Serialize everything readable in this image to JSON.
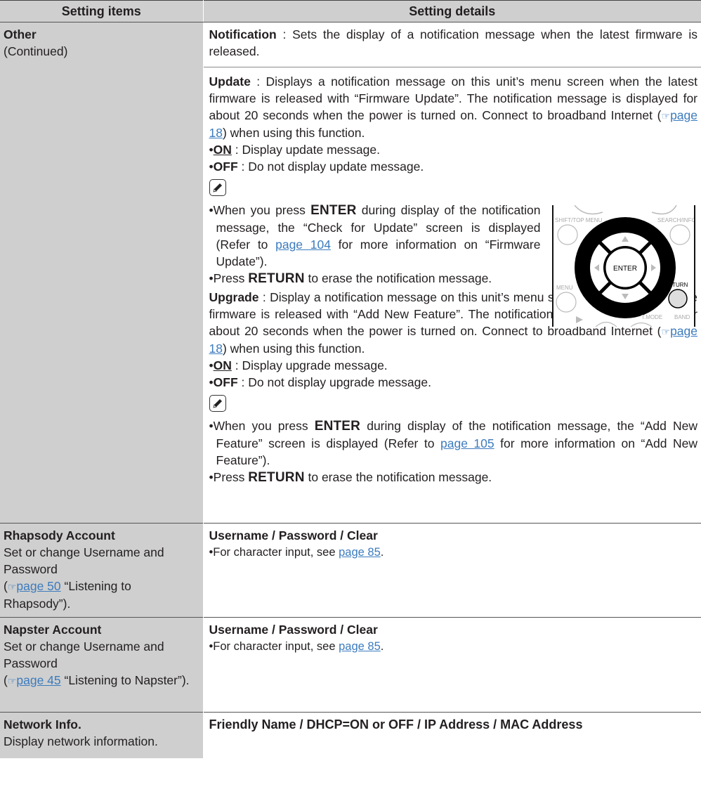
{
  "header": {
    "col1": "Setting items",
    "col2": "Setting details"
  },
  "other": {
    "title": "Other",
    "subtitle": "(Continued)",
    "notification": {
      "term": "Notification",
      "text": " : Sets the display of a notification message when the latest firmware is released."
    },
    "update": {
      "term": "Update",
      "text": "  : Displays a notification message on this unit’s menu screen when the latest firmware is released with “Firmware Update”. The notification message is displayed for about 20 seconds when the power is turned on. Connect to broadband Internet (",
      "link": "page 18",
      "text2": ") when using this function.",
      "on_label": "ON",
      "on_text": " : Display update message.",
      "off_label": "OFF",
      "off_text": " : Do not display update message.",
      "note1_a": "When you press ",
      "note1_enter": "ENTER",
      "note1_b": " during display of the notification message, the “Check for Update” screen is displayed (Refer to ",
      "note1_link": "page 104",
      "note1_c": " for more information on “Firmware Update”).",
      "note2_a": "Press ",
      "note2_return": "RETURN",
      "note2_b": " to erase the notification message."
    },
    "upgrade": {
      "term": "Upgrade",
      "text": " : Display a notification message on this unit’s menu screen when downloadable firmware is released with “Add New Feature”. The notification message is displayed for about 20 seconds when the power is turned on. Connect to broadband Internet (",
      "link": "page 18",
      "text2": ") when using this function.",
      "on_label": "ON",
      "on_text": " : Display upgrade message.",
      "off_label": "OFF",
      "off_text": " : Do not display upgrade message.",
      "note1_a": "When you press ",
      "note1_enter": "ENTER",
      "note1_b": " during display of the notification message, the “Add New Feature” screen is displayed (Refer to ",
      "note1_link": "page 105",
      "note1_c": " for more information on “Add New Feature”).",
      "note2_a": "Press ",
      "note2_return": "RETURN",
      "note2_b": " to erase the notification message."
    }
  },
  "remote": {
    "enter": "ENTER",
    "return": "RETURN",
    "menu": "MENU",
    "shift": "SHIFT/TOP MENU",
    "search": "SEARCH/INFO",
    "tmode": "T.MODE",
    "band": "BAND"
  },
  "rhapsody": {
    "title": "Rhapsody Account",
    "desc1": "Set or change Username and Password",
    "desc_link": "page 50",
    "desc2": " “Listening to Rhapsody”).",
    "detail_a": "Username",
    "detail_b": "Password",
    "detail_c": "Clear",
    "slash": " / ",
    "bullet_text": "For character input, see ",
    "bullet_link": "page 85",
    "bullet_end": "."
  },
  "napster": {
    "title": "Napster Account",
    "desc1": "Set or change Username and Password",
    "desc_link": "page 45",
    "desc2": " “Listening to Napster”).",
    "detail_a": "Username",
    "detail_b": "Password",
    "detail_c": "Clear",
    "slash": " / ",
    "bullet_text": "For character input, see ",
    "bullet_link": "page 85",
    "bullet_end": "."
  },
  "network": {
    "title": "Network Info.",
    "desc": "Display network information.",
    "detail": "Friendly Name / DHCP=ON or OFF / IP Address / MAC Address"
  }
}
